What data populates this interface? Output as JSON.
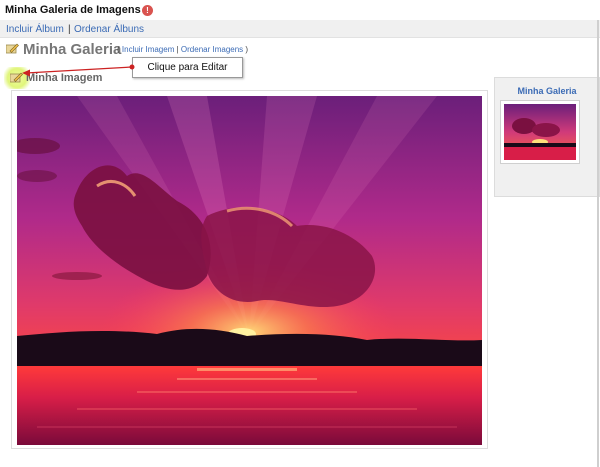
{
  "app": {
    "title": "Minha Galeria de Imagens"
  },
  "top_links": {
    "add_album": "Incluir Álbum",
    "sep": "|",
    "order_albums": "Ordenar Álbuns"
  },
  "gallery": {
    "title": "Minha Galeria",
    "links_open": "(",
    "add_image": "Incluir Imagem",
    "links_sep": "|",
    "order_images": "Ordenar Imagens",
    "links_close": ")"
  },
  "image": {
    "title": "Minha Imagem"
  },
  "tooltip": {
    "text": "Clique para Editar"
  },
  "sidebar": {
    "title": "Minha Galeria"
  },
  "icons": {
    "edit": "pencil-icon",
    "alert": "alert-icon"
  },
  "colors": {
    "link": "#3b6bb5",
    "accent_highlight": "#e0f57a",
    "arrow": "#cc2222"
  }
}
